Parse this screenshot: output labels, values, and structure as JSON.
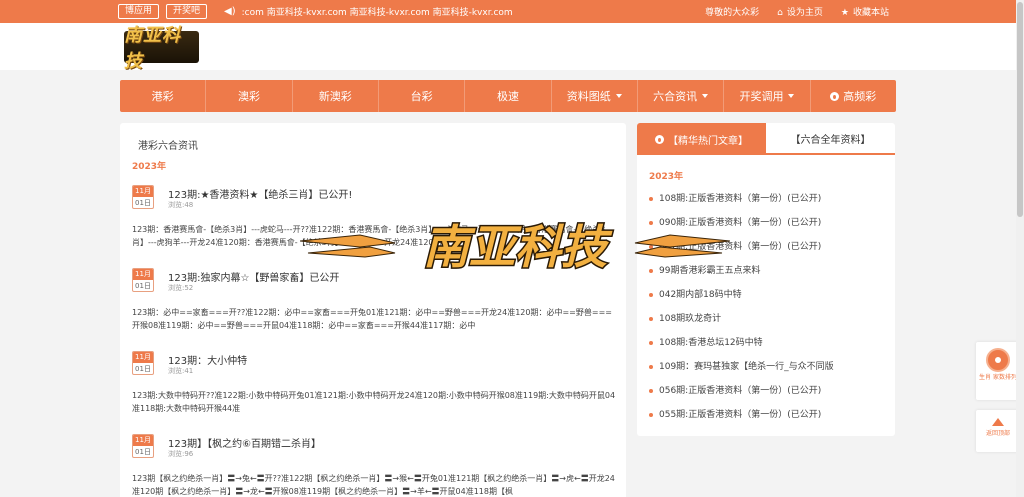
{
  "topbar": {
    "buttons": [
      "博应用",
      "开奖吧"
    ],
    "marquee": ":com 南亚科技-kvxr.com 南亚科技-kvxr.com 南亚科技-kvxr.com",
    "greeting": "尊敬的大众彩",
    "set_home": "设为主页",
    "bookmark": "收藏本站"
  },
  "logo": {
    "text": "南亚科技"
  },
  "nav": {
    "items": [
      "港彩",
      "澳彩",
      "新澳彩",
      "台彩",
      "极速",
      "资料图纸",
      "六合资讯",
      "开奖调用",
      "高频彩"
    ]
  },
  "main": {
    "title": "港彩六合资讯",
    "year": "2023年",
    "articles": [
      {
        "month": "11月",
        "day": "01日",
        "title": "123期:★香港资料★【绝杀三肖】已公开!",
        "views": "浏览:48",
        "body": "123期：香港赛馬會-【绝杀3肖】---虎蛇马---开??准122期：香港赛馬會-【绝杀3肖】---虎蛇马---开??准122期：香港赛馬會-【绝杀3肖】---虎狗羊---开龙24准120期：香港赛馬會-【绝杀3肖】---虎狗羊---开龙24准120期"
      },
      {
        "month": "11月",
        "day": "01日",
        "title": "123期:独家内幕☆【野兽家畜】已公开",
        "views": "浏览:52",
        "body": "123期：必中==家畜===开??准122期：必中==家畜===开兔01准121期：必中==野兽===开龙24准120期：必中==野兽===开猴08准119期：必中==野兽===开鼠04准118期：必中==家畜===开猴44准117期：必中"
      },
      {
        "month": "11月",
        "day": "01日",
        "title": "123期：大小仲特",
        "views": "浏览:41",
        "body": "123期:大数中特码开??准122期:小数中特码开兔01准121期:小数中特码开龙24准120期:小数中特码开猴08准119期:大数中特码开鼠04准118期:大数中特码开猴44准"
      },
      {
        "month": "11月",
        "day": "01日",
        "title": "123期】【枫之约⑥百期错二杀肖】",
        "views": "浏览:96",
        "body": "123期【枫之约绝杀一肖】〓→兔←〓开??准122期【枫之约绝杀一肖】〓→猴←〓开兔01准121期【枫之约绝杀一肖】〓→虎←〓开龙24准120期【枫之约绝杀一肖】〓→龙←〓开猴08准119期【枫之约绝杀一肖】〓→羊←〓开鼠04准118期【枫"
      }
    ]
  },
  "sidebar": {
    "tabs": [
      "【精华热门文章】",
      "【六合全年资料】"
    ],
    "year": "2023年",
    "items": [
      "108期:正版香港资料（第一份）(已公开)",
      "090期:正版香港资料（第一份）(已公开)",
      "091期:正版香港资料（第一份）(已公开)",
      "99期香港彩霸王五点来料",
      "042期内部18码中特",
      "108期玖龙奇计",
      "108期:香港总坛12码中特",
      "109期：赛玛甚独家【绝杀一行_与众不同版",
      "056期:正版香港资料（第一份）(已公开)",
      "055期:正版香港资料（第一份）(已公开)"
    ]
  },
  "float": {
    "lottery_label": "生肖\n家数排列",
    "back_top": "返回顶部"
  },
  "watermark": {
    "text": "南亚科技"
  },
  "colors": {
    "accent": "#ee7a4a"
  }
}
